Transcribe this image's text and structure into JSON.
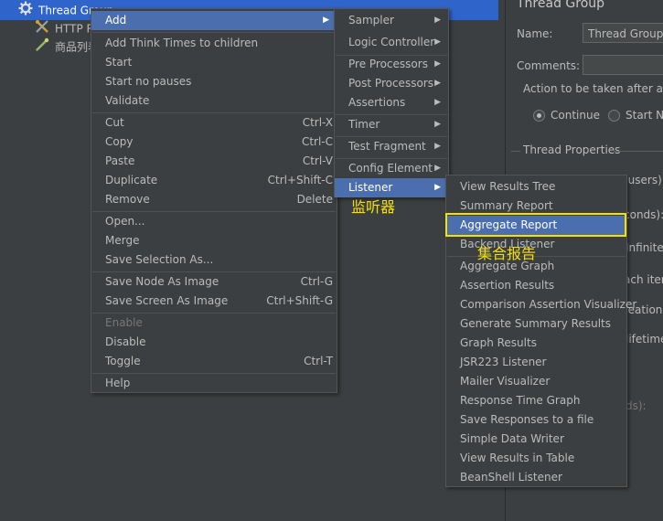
{
  "tree": {
    "thread_group": "Thread Group",
    "http_request": "HTTP R",
    "goods_list": "商品列表"
  },
  "right_panel": {
    "title": "Thread Group",
    "name_label": "Name:",
    "name_value": "Thread Group",
    "comments_label": "Comments:",
    "action_label": "Action to be taken after a San",
    "continue_label": "Continue",
    "start_next_label": "Start Ne",
    "thread_properties": "Thread Properties",
    "users_frag": "(users):",
    "seconds_frag": "conds):",
    "infinite_frag": "Infinite",
    "each_iter_frag": "ach itera",
    "creation_frag": "reation u",
    "lifetime_frag": "lifetime",
    "ds_frag": "ds):"
  },
  "context_menu": {
    "add": "Add",
    "add_think_times": "Add Think Times to children",
    "start": "Start",
    "start_no_pauses": "Start no pauses",
    "validate": "Validate",
    "cut": "Cut",
    "cut_sc": "Ctrl-X",
    "copy": "Copy",
    "copy_sc": "Ctrl-C",
    "paste": "Paste",
    "paste_sc": "Ctrl-V",
    "duplicate": "Duplicate",
    "duplicate_sc": "Ctrl+Shift-C",
    "remove": "Remove",
    "remove_sc": "Delete",
    "open": "Open...",
    "merge": "Merge",
    "save_selection_as": "Save Selection As...",
    "save_node_as_image": "Save Node As Image",
    "save_node_sc": "Ctrl-G",
    "save_screen_as_image": "Save Screen As Image",
    "save_screen_sc": "Ctrl+Shift-G",
    "enable": "Enable",
    "disable": "Disable",
    "toggle": "Toggle",
    "toggle_sc": "Ctrl-T",
    "help": "Help"
  },
  "add_submenu": {
    "sampler": "Sampler",
    "logic_controller": "Logic Controller",
    "pre_processors": "Pre Processors",
    "post_processors": "Post Processors",
    "assertions": "Assertions",
    "timer": "Timer",
    "test_fragment": "Test Fragment",
    "config_element": "Config Element",
    "listener": "Listener"
  },
  "listener_submenu": {
    "items": [
      "View Results Tree",
      "Summary Report",
      "Aggregate Report",
      "Backend Listener",
      "Aggregate Graph",
      "Assertion Results",
      "Comparison Assertion Visualizer",
      "Generate Summary Results",
      "Graph Results",
      "JSR223 Listener",
      "Mailer Visualizer",
      "Response Time Graph",
      "Save Responses to a file",
      "Simple Data Writer",
      "View Results in Table",
      "BeanShell Listener"
    ]
  },
  "annotations": {
    "listener_cn": "监听器",
    "aggregate_cn": "集合报告"
  },
  "colors": {
    "background": "#3c3f41",
    "selection": "#4b6eaf",
    "tree_selection": "#2f65ca",
    "annotation": "#f5e000"
  }
}
